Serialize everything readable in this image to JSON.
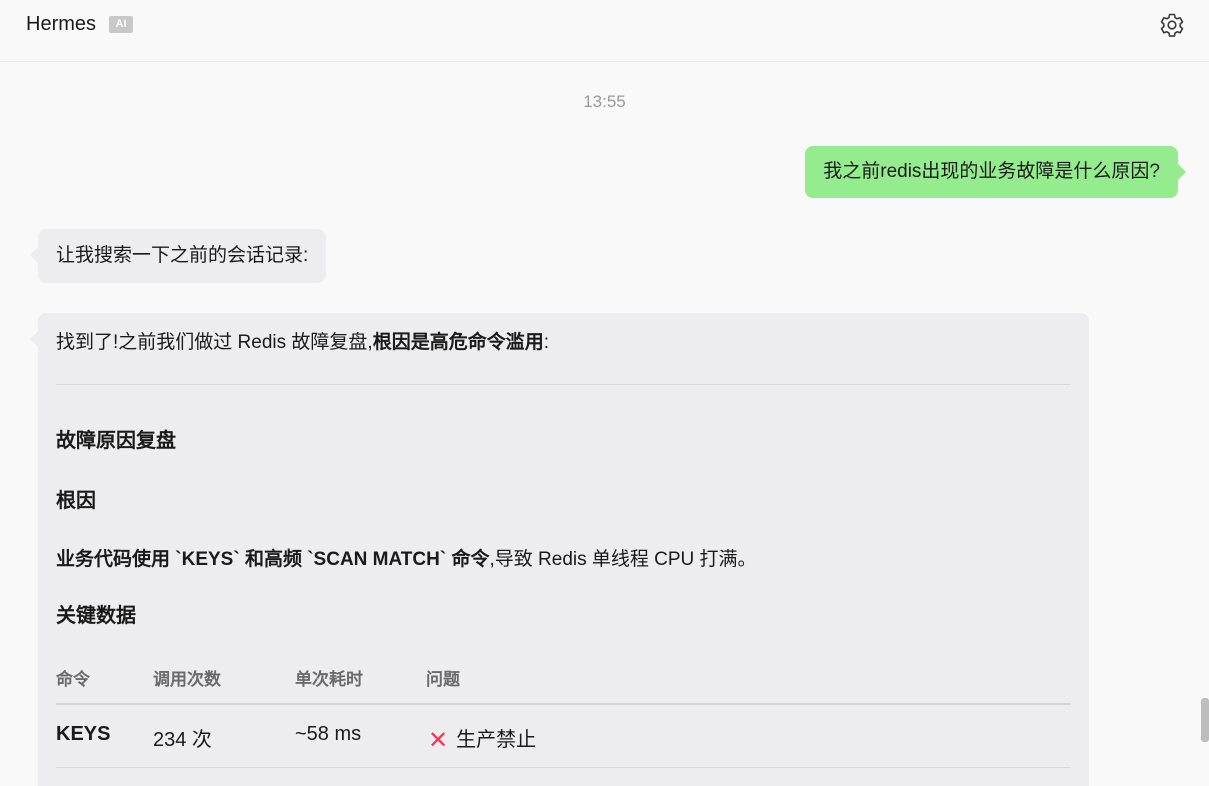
{
  "app": {
    "title": "Hermes",
    "badge": "AI"
  },
  "chat": {
    "timestamp": "13:55",
    "user_message": "我之前redis出现的业务故障是什么原因?",
    "ai_message_1": "让我搜索一下之前的会话记录:",
    "ai_message_2": {
      "intro_plain": "找到了!之前我们做过 Redis 故障复盘,",
      "intro_bold": "根因是高危命令滥用",
      "intro_tail": ":",
      "heading_cause": "故障原因复盘",
      "heading_root": "根因",
      "root_bold": "业务代码使用 `KEYS` 和高频 `SCAN MATCH` 命令",
      "root_tail": ",导致 Redis 单线程 CPU 打满。",
      "heading_data": "关键数据",
      "table": {
        "headers": [
          "命令",
          "调用次数",
          "单次耗时",
          "问题"
        ],
        "rows": [
          {
            "command": "KEYS",
            "calls": "234 次",
            "latency": "~58 ms",
            "issue_icon": "cross-mark-icon",
            "issue": "生产禁止"
          }
        ]
      }
    }
  },
  "colors": {
    "user_bubble": "#95ec8f",
    "ai_bubble": "#ededef",
    "cross_mark": "#f0365a",
    "badge": "#c8c8c8"
  }
}
